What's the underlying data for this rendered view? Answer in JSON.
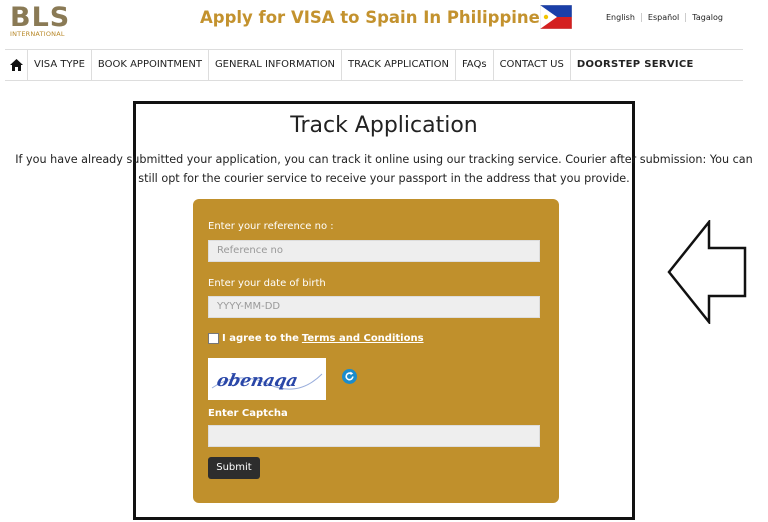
{
  "header": {
    "logo_main": "BLS",
    "logo_sub": "INTERNATIONAL",
    "site_title": "Apply for VISA to Spain In Philippines",
    "flag_icon": "philippines-flag-icon",
    "languages": [
      "English",
      "Español",
      "Tagalog"
    ]
  },
  "nav": {
    "home_icon": "home-icon",
    "items": [
      "VISA TYPE",
      "BOOK APPOINTMENT",
      "GENERAL INFORMATION",
      "TRACK APPLICATION",
      "FAQs",
      "CONTACT US",
      "DOORSTEP SERVICE"
    ]
  },
  "main": {
    "title": "Track Application",
    "intro_line1": "If you have already submitted your application, you can track it online using our tracking service. Courier after submission: You can",
    "intro_line2": "still opt for the courier service to receive your passport in the address that you provide."
  },
  "form": {
    "reference_label": "Enter your reference no :",
    "reference_placeholder": "Reference no",
    "dob_label": "Enter your date of birth",
    "dob_placeholder": "YYYY-MM-DD",
    "agree_text": "I agree to the",
    "terms_link": "Terms and Conditions",
    "captcha_text": "obenaqa",
    "refresh_icon": "refresh-icon",
    "captcha_label": "Enter Captcha",
    "captcha_value": "",
    "submit_label": "Submit"
  },
  "colors": {
    "brand_gold": "#c3922e",
    "card_bg": "#c0902c",
    "button_bg": "#2d2d2d"
  },
  "annotation": {
    "arrow_icon": "left-arrow-icon"
  }
}
